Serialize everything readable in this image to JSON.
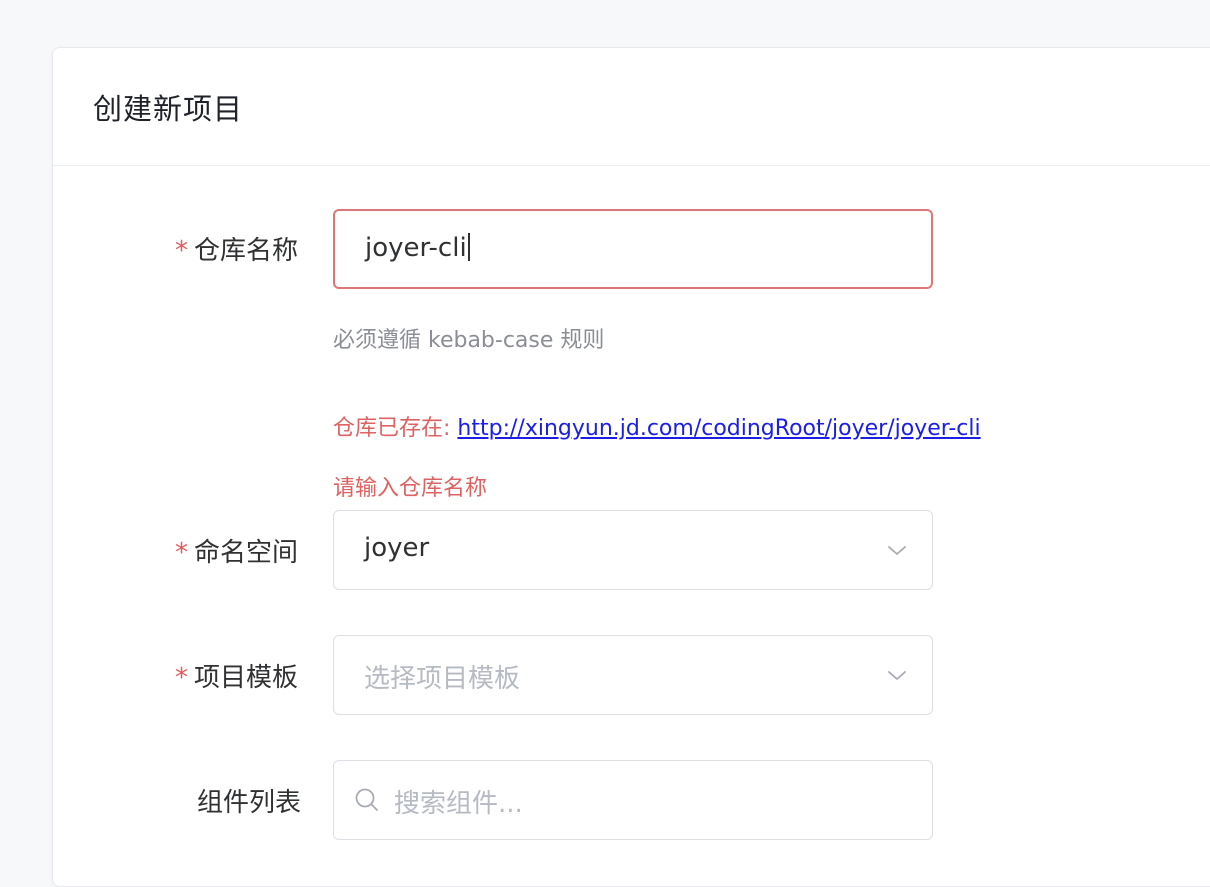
{
  "page": {
    "title": "创建新项目"
  },
  "form": {
    "repo": {
      "label": "仓库名称",
      "required_mark": "*",
      "value": "joyer-cli",
      "hint": "必须遵循 kebab-case 规则",
      "exists_prefix": "仓库已存在:",
      "exists_link": "http://xingyun.jd.com/codingRoot/joyer/joyer-cli",
      "error": "请输入仓库名称"
    },
    "namespace": {
      "label": "命名空间",
      "required_mark": "*",
      "value": "joyer",
      "icon": "chevron-down-icon"
    },
    "template": {
      "label": "项目模板",
      "required_mark": "*",
      "placeholder": "选择项目模板",
      "icon": "chevron-down-icon"
    },
    "components": {
      "label": "组件列表",
      "placeholder": "搜索组件...",
      "icon": "search-icon"
    }
  },
  "colors": {
    "required": "#e35a5a",
    "error_border": "#de7777",
    "error_text": "#de6262",
    "link": "#1a1ee6"
  }
}
